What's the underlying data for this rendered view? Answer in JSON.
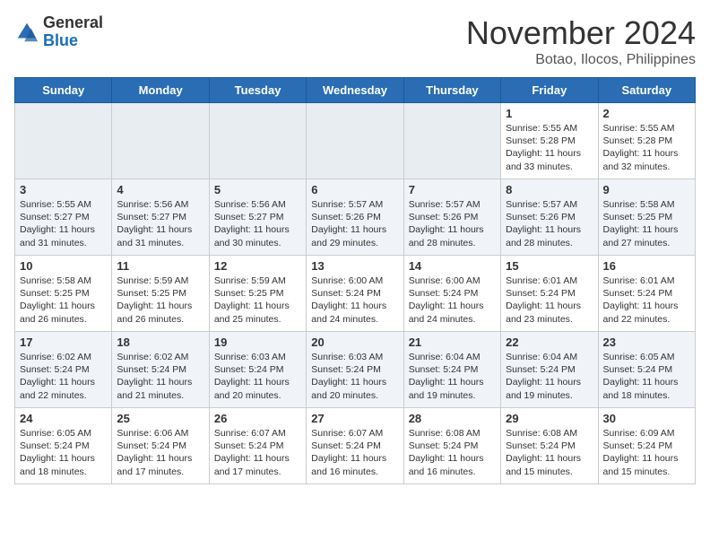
{
  "header": {
    "logo_general": "General",
    "logo_blue": "Blue",
    "month_year": "November 2024",
    "location": "Botao, Ilocos, Philippines"
  },
  "weekdays": [
    "Sunday",
    "Monday",
    "Tuesday",
    "Wednesday",
    "Thursday",
    "Friday",
    "Saturday"
  ],
  "weeks": [
    [
      {
        "day": "",
        "text": ""
      },
      {
        "day": "",
        "text": ""
      },
      {
        "day": "",
        "text": ""
      },
      {
        "day": "",
        "text": ""
      },
      {
        "day": "",
        "text": ""
      },
      {
        "day": "1",
        "text": "Sunrise: 5:55 AM\nSunset: 5:28 PM\nDaylight: 11 hours and 33 minutes."
      },
      {
        "day": "2",
        "text": "Sunrise: 5:55 AM\nSunset: 5:28 PM\nDaylight: 11 hours and 32 minutes."
      }
    ],
    [
      {
        "day": "3",
        "text": "Sunrise: 5:55 AM\nSunset: 5:27 PM\nDaylight: 11 hours and 31 minutes."
      },
      {
        "day": "4",
        "text": "Sunrise: 5:56 AM\nSunset: 5:27 PM\nDaylight: 11 hours and 31 minutes."
      },
      {
        "day": "5",
        "text": "Sunrise: 5:56 AM\nSunset: 5:27 PM\nDaylight: 11 hours and 30 minutes."
      },
      {
        "day": "6",
        "text": "Sunrise: 5:57 AM\nSunset: 5:26 PM\nDaylight: 11 hours and 29 minutes."
      },
      {
        "day": "7",
        "text": "Sunrise: 5:57 AM\nSunset: 5:26 PM\nDaylight: 11 hours and 28 minutes."
      },
      {
        "day": "8",
        "text": "Sunrise: 5:57 AM\nSunset: 5:26 PM\nDaylight: 11 hours and 28 minutes."
      },
      {
        "day": "9",
        "text": "Sunrise: 5:58 AM\nSunset: 5:25 PM\nDaylight: 11 hours and 27 minutes."
      }
    ],
    [
      {
        "day": "10",
        "text": "Sunrise: 5:58 AM\nSunset: 5:25 PM\nDaylight: 11 hours and 26 minutes."
      },
      {
        "day": "11",
        "text": "Sunrise: 5:59 AM\nSunset: 5:25 PM\nDaylight: 11 hours and 26 minutes."
      },
      {
        "day": "12",
        "text": "Sunrise: 5:59 AM\nSunset: 5:25 PM\nDaylight: 11 hours and 25 minutes."
      },
      {
        "day": "13",
        "text": "Sunrise: 6:00 AM\nSunset: 5:24 PM\nDaylight: 11 hours and 24 minutes."
      },
      {
        "day": "14",
        "text": "Sunrise: 6:00 AM\nSunset: 5:24 PM\nDaylight: 11 hours and 24 minutes."
      },
      {
        "day": "15",
        "text": "Sunrise: 6:01 AM\nSunset: 5:24 PM\nDaylight: 11 hours and 23 minutes."
      },
      {
        "day": "16",
        "text": "Sunrise: 6:01 AM\nSunset: 5:24 PM\nDaylight: 11 hours and 22 minutes."
      }
    ],
    [
      {
        "day": "17",
        "text": "Sunrise: 6:02 AM\nSunset: 5:24 PM\nDaylight: 11 hours and 22 minutes."
      },
      {
        "day": "18",
        "text": "Sunrise: 6:02 AM\nSunset: 5:24 PM\nDaylight: 11 hours and 21 minutes."
      },
      {
        "day": "19",
        "text": "Sunrise: 6:03 AM\nSunset: 5:24 PM\nDaylight: 11 hours and 20 minutes."
      },
      {
        "day": "20",
        "text": "Sunrise: 6:03 AM\nSunset: 5:24 PM\nDaylight: 11 hours and 20 minutes."
      },
      {
        "day": "21",
        "text": "Sunrise: 6:04 AM\nSunset: 5:24 PM\nDaylight: 11 hours and 19 minutes."
      },
      {
        "day": "22",
        "text": "Sunrise: 6:04 AM\nSunset: 5:24 PM\nDaylight: 11 hours and 19 minutes."
      },
      {
        "day": "23",
        "text": "Sunrise: 6:05 AM\nSunset: 5:24 PM\nDaylight: 11 hours and 18 minutes."
      }
    ],
    [
      {
        "day": "24",
        "text": "Sunrise: 6:05 AM\nSunset: 5:24 PM\nDaylight: 11 hours and 18 minutes."
      },
      {
        "day": "25",
        "text": "Sunrise: 6:06 AM\nSunset: 5:24 PM\nDaylight: 11 hours and 17 minutes."
      },
      {
        "day": "26",
        "text": "Sunrise: 6:07 AM\nSunset: 5:24 PM\nDaylight: 11 hours and 17 minutes."
      },
      {
        "day": "27",
        "text": "Sunrise: 6:07 AM\nSunset: 5:24 PM\nDaylight: 11 hours and 16 minutes."
      },
      {
        "day": "28",
        "text": "Sunrise: 6:08 AM\nSunset: 5:24 PM\nDaylight: 11 hours and 16 minutes."
      },
      {
        "day": "29",
        "text": "Sunrise: 6:08 AM\nSunset: 5:24 PM\nDaylight: 11 hours and 15 minutes."
      },
      {
        "day": "30",
        "text": "Sunrise: 6:09 AM\nSunset: 5:24 PM\nDaylight: 11 hours and 15 minutes."
      }
    ]
  ]
}
